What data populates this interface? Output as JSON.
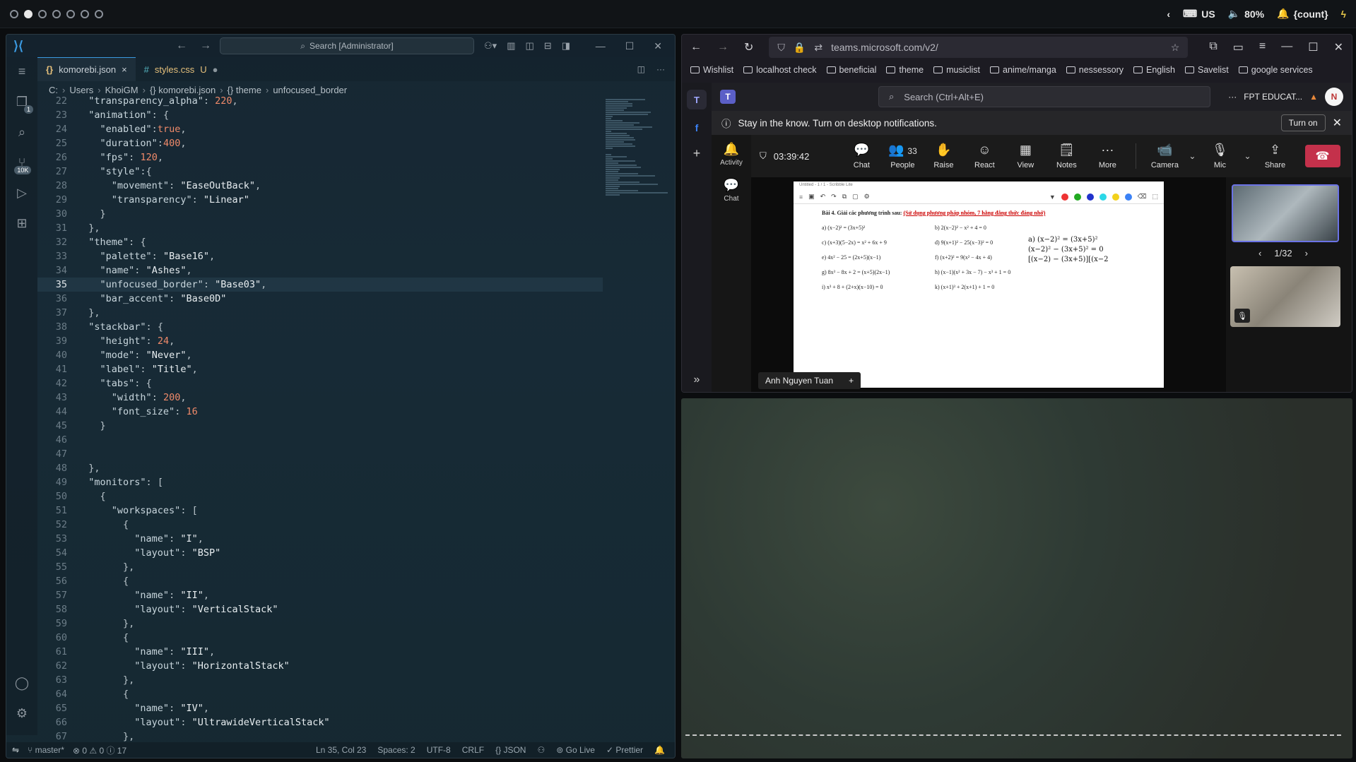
{
  "topbar": {
    "workspaces": 7,
    "active_workspace": 2,
    "lang": "US",
    "volume": "80%",
    "notif": "{count}"
  },
  "vscode": {
    "search_placeholder": "Search [Administrator]",
    "tabs": [
      {
        "icon": "{}",
        "label": "komorebi.json",
        "active": true,
        "close": "×"
      },
      {
        "icon": "#",
        "label": "styles.css",
        "badge": "U",
        "modified": "●"
      }
    ],
    "breadcrumb": [
      "C:",
      "Users",
      "KhoiGM",
      "{} komorebi.json",
      "{} theme",
      "unfocused_border"
    ],
    "code": [
      {
        "n": "22",
        "t": "  \"transparency_alpha\": 220,"
      },
      {
        "n": "23",
        "t": "  \"animation\": {"
      },
      {
        "n": "24",
        "t": "    \"enabled\":true,"
      },
      {
        "n": "25",
        "t": "    \"duration\":400,"
      },
      {
        "n": "26",
        "t": "    \"fps\": 120,"
      },
      {
        "n": "27",
        "t": "    \"style\":{"
      },
      {
        "n": "28",
        "t": "      \"movement\": \"EaseOutBack\","
      },
      {
        "n": "29",
        "t": "      \"transparency\": \"Linear\""
      },
      {
        "n": "30",
        "t": "    }"
      },
      {
        "n": "31",
        "t": "  },"
      },
      {
        "n": "32",
        "t": "  \"theme\": {"
      },
      {
        "n": "33",
        "t": "    \"palette\": \"Base16\","
      },
      {
        "n": "34",
        "t": "    \"name\": \"Ashes\","
      },
      {
        "n": "35",
        "t": "    \"unfocused_border\": \"Base03\","
      },
      {
        "n": "36",
        "t": "    \"bar_accent\": \"Base0D\""
      },
      {
        "n": "37",
        "t": "  },"
      },
      {
        "n": "38",
        "t": "  \"stackbar\": {"
      },
      {
        "n": "39",
        "t": "    \"height\": 24,"
      },
      {
        "n": "40",
        "t": "    \"mode\": \"Never\","
      },
      {
        "n": "41",
        "t": "    \"label\": \"Title\","
      },
      {
        "n": "42",
        "t": "    \"tabs\": {"
      },
      {
        "n": "43",
        "t": "      \"width\": 200,"
      },
      {
        "n": "44",
        "t": "      \"font_size\": 16"
      },
      {
        "n": "45",
        "t": "    }"
      },
      {
        "n": "46",
        "t": ""
      },
      {
        "n": "47",
        "t": ""
      },
      {
        "n": "48",
        "t": "  },"
      },
      {
        "n": "49",
        "t": "  \"monitors\": ["
      },
      {
        "n": "50",
        "t": "    {"
      },
      {
        "n": "51",
        "t": "      \"workspaces\": ["
      },
      {
        "n": "52",
        "t": "        {"
      },
      {
        "n": "53",
        "t": "          \"name\": \"I\","
      },
      {
        "n": "54",
        "t": "          \"layout\": \"BSP\""
      },
      {
        "n": "55",
        "t": "        },"
      },
      {
        "n": "56",
        "t": "        {"
      },
      {
        "n": "57",
        "t": "          \"name\": \"II\","
      },
      {
        "n": "58",
        "t": "          \"layout\": \"VerticalStack\""
      },
      {
        "n": "59",
        "t": "        },"
      },
      {
        "n": "60",
        "t": "        {"
      },
      {
        "n": "61",
        "t": "          \"name\": \"III\","
      },
      {
        "n": "62",
        "t": "          \"layout\": \"HorizontalStack\""
      },
      {
        "n": "63",
        "t": "        },"
      },
      {
        "n": "64",
        "t": "        {"
      },
      {
        "n": "65",
        "t": "          \"name\": \"IV\","
      },
      {
        "n": "66",
        "t": "          \"layout\": \"UltrawideVerticalStack\""
      },
      {
        "n": "67",
        "t": "        },"
      }
    ],
    "current_line": "35",
    "status": {
      "branch": "master*",
      "problems": "⊗ 0 ⚠ 0 ⓘ 17",
      "position": "Ln 35, Col 23",
      "spaces": "Spaces: 2",
      "encoding": "UTF-8",
      "eol": "CRLF",
      "language": "JSON",
      "golive": "Go Live",
      "prettier": "Prettier"
    },
    "activity_badges": {
      "scm": "1",
      "extensions": "10K"
    }
  },
  "browser": {
    "url": "teams.microsoft.com/v2/",
    "bookmarks": [
      "Wishlist",
      "localhost check",
      "beneficial",
      "theme",
      "musiclist",
      "anime/manga",
      "nessessory",
      "English",
      "Savelist",
      "google services"
    ]
  },
  "teams": {
    "search_placeholder": "Search (Ctrl+Alt+E)",
    "org": "FPT EDUCAT...",
    "avatar_initial": "N",
    "banner": "Stay in the know. Turn on desktop notifications.",
    "banner_button": "Turn on",
    "side": [
      "Activity",
      "Chat"
    ],
    "timer": "03:39:42",
    "toolbar": [
      {
        "icon": "💬",
        "label": "Chat"
      },
      {
        "icon": "👥",
        "label": "People",
        "count": "33"
      },
      {
        "icon": "✋",
        "label": "Raise"
      },
      {
        "icon": "☺",
        "label": "React"
      },
      {
        "icon": "▦",
        "label": "View"
      },
      {
        "icon": "🗒",
        "label": "Notes"
      },
      {
        "icon": "···",
        "label": "More"
      }
    ],
    "camera": "Camera",
    "mic": "Mic",
    "share": "Share",
    "presenter": "Anh Nguyen Tuan",
    "pager": "1/32",
    "slide": {
      "top": "Untitled - 1 / 1 - Scribble Lite",
      "title": "Bài 4. Giải các phương trình sau: ",
      "title_red": "(Sử dụng phương pháp nhóm, 7 hằng đẳng thức đáng nhớ)",
      "equations": [
        "a) (x−2)² = (3x+5)²",
        "b) 2(x−2)² − x² + 4 = 0",
        "c) (x+3)(5−2x) = x² + 6x + 9",
        "d) 9(x+1)² − 25(x−3)² = 0",
        "e) 4x² − 25 = (2x+5)(x−1)",
        "f) (x+2)² = 9(x² − 4x + 4)",
        "g) 8x³ − 8x + 2 = (x+5)(2x−1)",
        "h) (x−1)(x² + 3x − 7) − x³ + 1 = 0",
        "i) x³ + 8 + (2+x)(x−10) = 0",
        "k) (x+1)³ + 2(x+1) + 1 = 0"
      ],
      "handwriting": [
        "a) (x−2)² = (3x+5)²",
        "(x−2)² − (3x+5)² = 0",
        "[(x−2) − (3x+5)][(x−2"
      ]
    }
  }
}
